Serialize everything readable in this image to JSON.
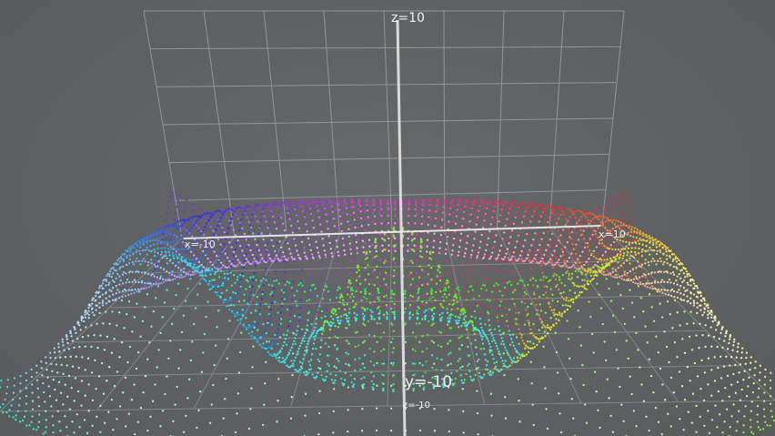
{
  "plot": {
    "axis_labels": {
      "z_max": "z=10",
      "z_min": "z=-10",
      "x_min": "x=-10",
      "x_max": "x=10",
      "y_min": "y=-10"
    },
    "colors": {
      "background": "#5f6163",
      "grid": "#9ea0a2",
      "axis": "#e8e8e8",
      "surface_magenta": "#e060e0",
      "surface_cyan": "#30e8f0",
      "surface_yellow": "#f0f040",
      "surface_green": "#70e020",
      "surface_orange": "#ff6a10",
      "surface_blue": "#3040c0"
    }
  }
}
